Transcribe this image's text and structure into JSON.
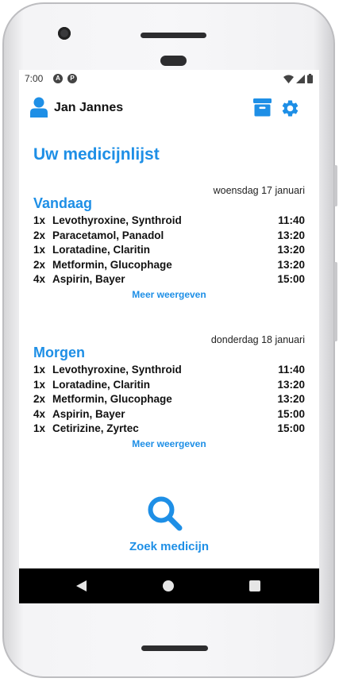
{
  "statusbar": {
    "time": "7:00",
    "icons": [
      "a-notification-icon",
      "p-notification-icon",
      "wifi-icon",
      "signal-icon",
      "battery-icon"
    ]
  },
  "header": {
    "user_name": "Jan Jannes",
    "icons": [
      "user-icon",
      "archive-icon",
      "gear-icon"
    ]
  },
  "page_title": "Uw medicijnlijst",
  "today": {
    "date": "woensdag 17 januari",
    "heading": "Vandaag",
    "meds": [
      {
        "qty": "1x",
        "name": "Levothyroxine, Synthroid",
        "time": "11:40"
      },
      {
        "qty": "2x",
        "name": "Paracetamol, Panadol",
        "time": "13:20"
      },
      {
        "qty": "1x",
        "name": "Loratadine, Claritin",
        "time": "13:20"
      },
      {
        "qty": "2x",
        "name": "Metformin, Glucophage",
        "time": "13:20"
      },
      {
        "qty": "4x",
        "name": "Aspirin, Bayer",
        "time": "15:00"
      }
    ],
    "more_label": "Meer weergeven"
  },
  "tomorrow": {
    "date": "donderdag 18 januari",
    "heading": "Morgen",
    "meds": [
      {
        "qty": "1x",
        "name": "Levothyroxine, Synthroid",
        "time": "11:40"
      },
      {
        "qty": "1x",
        "name": "Loratadine, Claritin",
        "time": "13:20"
      },
      {
        "qty": "2x",
        "name": "Metformin, Glucophage",
        "time": "13:20"
      },
      {
        "qty": "4x",
        "name": "Aspirin, Bayer",
        "time": "15:00"
      },
      {
        "qty": "1x",
        "name": "Cetirizine, Zyrtec",
        "time": "15:00"
      }
    ],
    "more_label": "Meer weergeven"
  },
  "search": {
    "label": "Zoek medicijn",
    "icon": "search-icon"
  },
  "navbar": {
    "icons": [
      "back-icon",
      "home-icon",
      "recents-icon"
    ]
  },
  "colors": {
    "accent": "#1e8fe6",
    "text": "#111111",
    "navbar": "#000000"
  }
}
